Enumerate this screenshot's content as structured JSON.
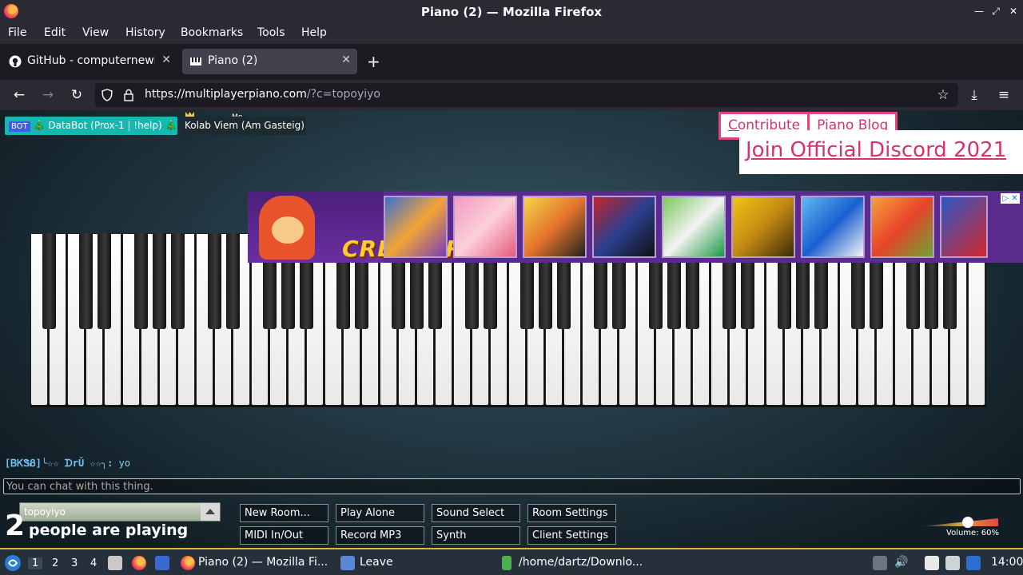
{
  "window": {
    "title": "Piano (2) — Mozilla Firefox"
  },
  "menu": [
    "File",
    "Edit",
    "View",
    "History",
    "Bookmarks",
    "Tools",
    "Help"
  ],
  "tabs": [
    {
      "label": "GitHub - computernewb/",
      "icon": "github-icon",
      "active": false
    },
    {
      "label": "Piano (2)",
      "icon": "piano-icon",
      "active": true
    }
  ],
  "nav": {
    "url_host": "https://multiplayerpiano.com",
    "url_rest": "/?c=topoyiyo"
  },
  "page": {
    "users": {
      "databot_badge": "BOT",
      "databot": "🎄 DataBot (Prox-1 | !help) 🎄",
      "kolab": "Kolab Viem (Am Gasteig)",
      "me_label": "Me"
    },
    "links": {
      "contribute": "Contribute",
      "blog": "Piano Blog",
      "discord": "Join Official Discord 2021"
    },
    "ad": {
      "brand": "CREETOR",
      "close": "▷ ✕"
    },
    "chat": {
      "author": "[ᏴᏦᏕᏰ]╰☆☆ ᗪrǓ ☆☆╮:",
      "message": "yo",
      "placeholder": "You can chat with this thing."
    },
    "room_name": "topoyiyo",
    "people_count": "2",
    "people_label": "people are playing",
    "buttons": {
      "new_room": "New Room...",
      "play_alone": "Play Alone",
      "sound_select": "Sound Select",
      "room_settings": "Room Settings",
      "midi": "MIDI In/Out",
      "record": "Record MP3",
      "synth": "Synth",
      "client_settings": "Client Settings"
    },
    "volume": {
      "label": "Volume: 60%",
      "value": 0.6
    }
  },
  "taskbar": {
    "workspaces": [
      "1",
      "2",
      "3",
      "4"
    ],
    "tasks": [
      "Piano (2) — Mozilla Fi...",
      "Leave",
      "/home/dartz/Downlo..."
    ],
    "clock": "14:00"
  },
  "colors": {
    "accent": "#e5447e",
    "bot": "#16b7b0",
    "chrome": "#2b2a33"
  }
}
